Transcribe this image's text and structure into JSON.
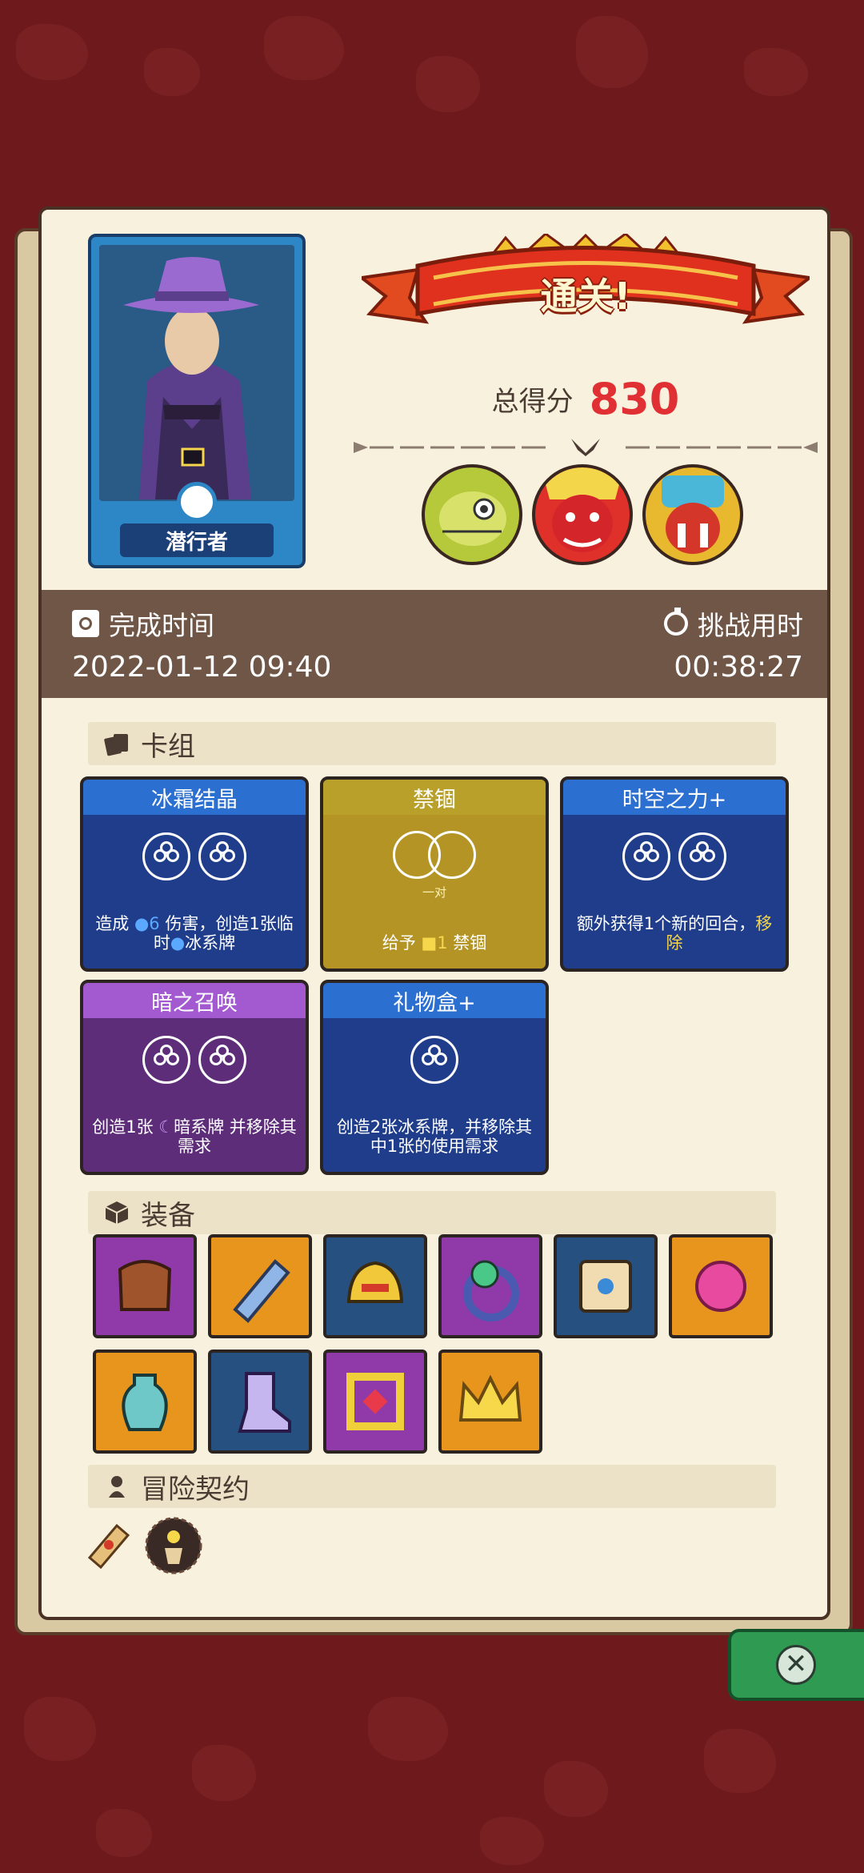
{
  "hero": {
    "name": "潜行者"
  },
  "result": {
    "banner": "通关!",
    "score_label": "总得分",
    "score": "830"
  },
  "bosses": [
    "dinosaur-boss-portrait",
    "red-demon-boss-portrait",
    "masked-boss-portrait"
  ],
  "time": {
    "finish_label": "完成时间",
    "finish_value": "2022-01-12 09:40",
    "duration_label": "挑战用时",
    "duration_value": "00:38:27"
  },
  "sections": {
    "deck": "卡组",
    "equipment": "装备",
    "contract": "冒险契约"
  },
  "cards": [
    {
      "title": "冰霜结晶",
      "desc_a": "造成 ",
      "desc_num": "6",
      "desc_b": " 伤害，创造1张临时",
      "desc_c": "冰系牌"
    },
    {
      "title": "禁锢",
      "pair": "一对",
      "desc_a": "给予 ",
      "desc_num": "1",
      "desc_b": " 禁锢"
    },
    {
      "title": "时空之力+",
      "desc_a": "额外获得1个新的回合，",
      "desc_hl": "移除"
    },
    {
      "title": "暗之召唤",
      "desc_a": "创造1张 ",
      "desc_b": "暗系牌 并移除其需求"
    },
    {
      "title": "礼物盒+",
      "desc_a": "创造2张冰系牌，并移除其中1张的使用需求"
    }
  ],
  "equipment": [
    "leather-armor",
    "ice-bottle",
    "golden-helmet",
    "gem-ring",
    "scroll",
    "fire-orb",
    "vase",
    "boot",
    "gem-frame",
    "crown"
  ],
  "colors": {
    "bg": "#6e1a1c",
    "paper": "#f8f1dd",
    "score": "#e13033",
    "close": "#2f9a52"
  }
}
